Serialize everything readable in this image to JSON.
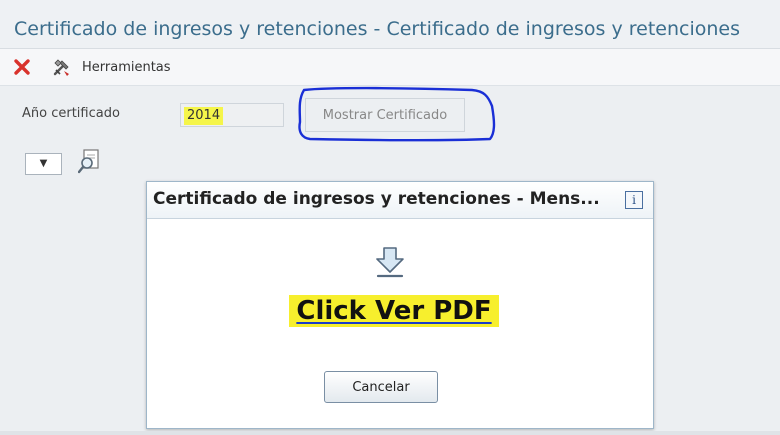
{
  "window": {
    "title": "Certificado de ingresos y retenciones - Certificado de ingresos y retenciones"
  },
  "toolbar": {
    "close_icon": "red-x-icon",
    "tools_icon": "tools-icon",
    "tools_label": "Herramientas"
  },
  "form": {
    "year_label": "Año certificado",
    "year_value": "2014",
    "show_button_label": "Mostrar Certificado",
    "dropdown_arrow": "▼",
    "search_icon": "search-document-icon"
  },
  "dialog": {
    "title": "Certificado de ingresos y retenciones - Mens...",
    "info_icon": "i",
    "download_icon": "download-arrow-icon",
    "link_label": "Click Ver PDF",
    "cancel_label": "Cancelar"
  },
  "colors": {
    "title": "#3b6d8c",
    "highlight": "#f5f54a",
    "annotation_circle": "#1a2fd6",
    "close_icon": "#d9322c"
  }
}
